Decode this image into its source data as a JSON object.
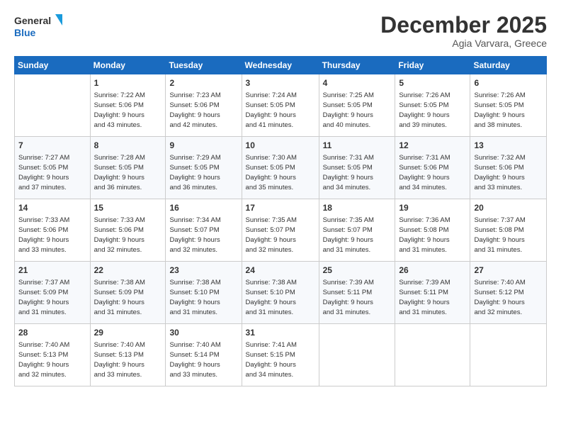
{
  "header": {
    "logo_line1": "General",
    "logo_line2": "Blue",
    "month": "December 2025",
    "location": "Agia Varvara, Greece"
  },
  "calendar": {
    "days_of_week": [
      "Sunday",
      "Monday",
      "Tuesday",
      "Wednesday",
      "Thursday",
      "Friday",
      "Saturday"
    ],
    "weeks": [
      [
        {
          "day": "",
          "info": ""
        },
        {
          "day": "1",
          "info": "Sunrise: 7:22 AM\nSunset: 5:06 PM\nDaylight: 9 hours\nand 43 minutes."
        },
        {
          "day": "2",
          "info": "Sunrise: 7:23 AM\nSunset: 5:06 PM\nDaylight: 9 hours\nand 42 minutes."
        },
        {
          "day": "3",
          "info": "Sunrise: 7:24 AM\nSunset: 5:05 PM\nDaylight: 9 hours\nand 41 minutes."
        },
        {
          "day": "4",
          "info": "Sunrise: 7:25 AM\nSunset: 5:05 PM\nDaylight: 9 hours\nand 40 minutes."
        },
        {
          "day": "5",
          "info": "Sunrise: 7:26 AM\nSunset: 5:05 PM\nDaylight: 9 hours\nand 39 minutes."
        },
        {
          "day": "6",
          "info": "Sunrise: 7:26 AM\nSunset: 5:05 PM\nDaylight: 9 hours\nand 38 minutes."
        }
      ],
      [
        {
          "day": "7",
          "info": "Sunrise: 7:27 AM\nSunset: 5:05 PM\nDaylight: 9 hours\nand 37 minutes."
        },
        {
          "day": "8",
          "info": "Sunrise: 7:28 AM\nSunset: 5:05 PM\nDaylight: 9 hours\nand 36 minutes."
        },
        {
          "day": "9",
          "info": "Sunrise: 7:29 AM\nSunset: 5:05 PM\nDaylight: 9 hours\nand 36 minutes."
        },
        {
          "day": "10",
          "info": "Sunrise: 7:30 AM\nSunset: 5:05 PM\nDaylight: 9 hours\nand 35 minutes."
        },
        {
          "day": "11",
          "info": "Sunrise: 7:31 AM\nSunset: 5:05 PM\nDaylight: 9 hours\nand 34 minutes."
        },
        {
          "day": "12",
          "info": "Sunrise: 7:31 AM\nSunset: 5:06 PM\nDaylight: 9 hours\nand 34 minutes."
        },
        {
          "day": "13",
          "info": "Sunrise: 7:32 AM\nSunset: 5:06 PM\nDaylight: 9 hours\nand 33 minutes."
        }
      ],
      [
        {
          "day": "14",
          "info": "Sunrise: 7:33 AM\nSunset: 5:06 PM\nDaylight: 9 hours\nand 33 minutes."
        },
        {
          "day": "15",
          "info": "Sunrise: 7:33 AM\nSunset: 5:06 PM\nDaylight: 9 hours\nand 32 minutes."
        },
        {
          "day": "16",
          "info": "Sunrise: 7:34 AM\nSunset: 5:07 PM\nDaylight: 9 hours\nand 32 minutes."
        },
        {
          "day": "17",
          "info": "Sunrise: 7:35 AM\nSunset: 5:07 PM\nDaylight: 9 hours\nand 32 minutes."
        },
        {
          "day": "18",
          "info": "Sunrise: 7:35 AM\nSunset: 5:07 PM\nDaylight: 9 hours\nand 31 minutes."
        },
        {
          "day": "19",
          "info": "Sunrise: 7:36 AM\nSunset: 5:08 PM\nDaylight: 9 hours\nand 31 minutes."
        },
        {
          "day": "20",
          "info": "Sunrise: 7:37 AM\nSunset: 5:08 PM\nDaylight: 9 hours\nand 31 minutes."
        }
      ],
      [
        {
          "day": "21",
          "info": "Sunrise: 7:37 AM\nSunset: 5:09 PM\nDaylight: 9 hours\nand 31 minutes."
        },
        {
          "day": "22",
          "info": "Sunrise: 7:38 AM\nSunset: 5:09 PM\nDaylight: 9 hours\nand 31 minutes."
        },
        {
          "day": "23",
          "info": "Sunrise: 7:38 AM\nSunset: 5:10 PM\nDaylight: 9 hours\nand 31 minutes."
        },
        {
          "day": "24",
          "info": "Sunrise: 7:38 AM\nSunset: 5:10 PM\nDaylight: 9 hours\nand 31 minutes."
        },
        {
          "day": "25",
          "info": "Sunrise: 7:39 AM\nSunset: 5:11 PM\nDaylight: 9 hours\nand 31 minutes."
        },
        {
          "day": "26",
          "info": "Sunrise: 7:39 AM\nSunset: 5:11 PM\nDaylight: 9 hours\nand 31 minutes."
        },
        {
          "day": "27",
          "info": "Sunrise: 7:40 AM\nSunset: 5:12 PM\nDaylight: 9 hours\nand 32 minutes."
        }
      ],
      [
        {
          "day": "28",
          "info": "Sunrise: 7:40 AM\nSunset: 5:13 PM\nDaylight: 9 hours\nand 32 minutes."
        },
        {
          "day": "29",
          "info": "Sunrise: 7:40 AM\nSunset: 5:13 PM\nDaylight: 9 hours\nand 33 minutes."
        },
        {
          "day": "30",
          "info": "Sunrise: 7:40 AM\nSunset: 5:14 PM\nDaylight: 9 hours\nand 33 minutes."
        },
        {
          "day": "31",
          "info": "Sunrise: 7:41 AM\nSunset: 5:15 PM\nDaylight: 9 hours\nand 34 minutes."
        },
        {
          "day": "",
          "info": ""
        },
        {
          "day": "",
          "info": ""
        },
        {
          "day": "",
          "info": ""
        }
      ]
    ]
  }
}
